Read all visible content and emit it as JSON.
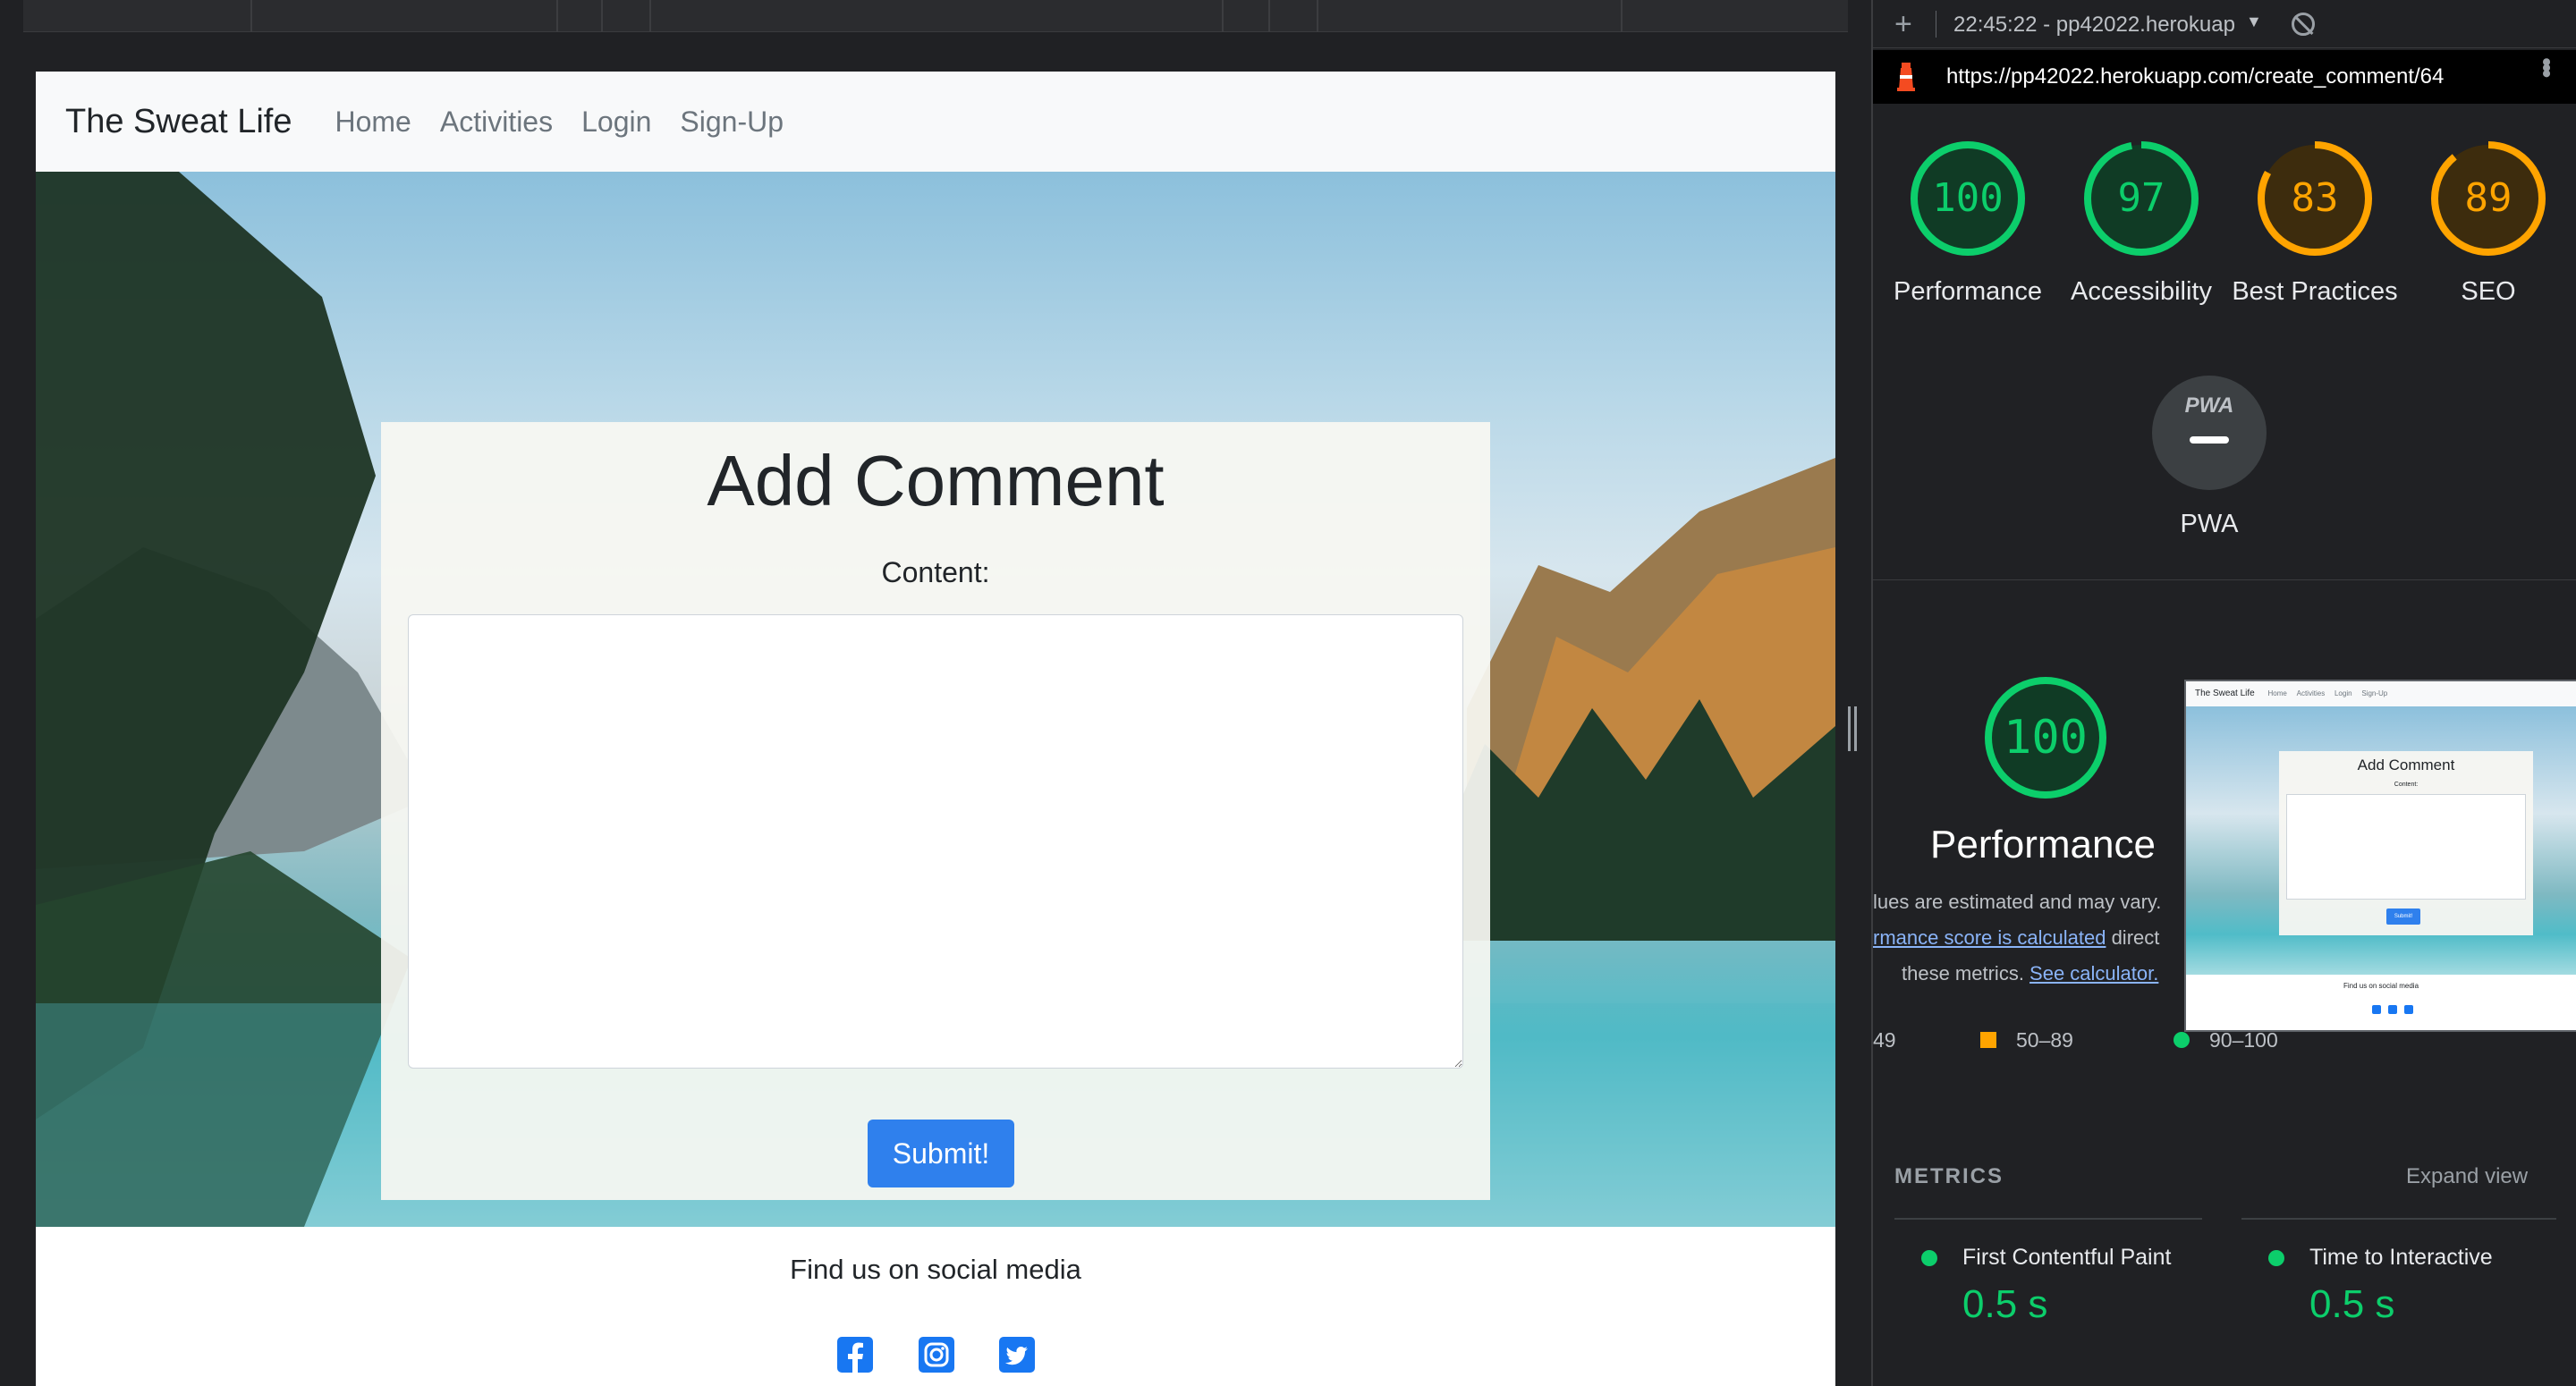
{
  "page": {
    "brand": "The Sweat Life",
    "nav": [
      "Home",
      "Activities",
      "Login",
      "Sign-Up"
    ],
    "form": {
      "title": "Add Comment",
      "content_label": "Content:",
      "content_value": "",
      "submit_label": "Submit!"
    },
    "footer": {
      "text": "Find us on social media",
      "icons": [
        "facebook-icon",
        "instagram-icon",
        "twitter-icon"
      ]
    }
  },
  "lighthouse": {
    "run_label": "22:45:22 - pp42022.herokuap",
    "url": "https://pp42022.herokuapp.com/create_comment/64",
    "scores": [
      {
        "label": "Performance",
        "value": "100",
        "color": "#0cce6b"
      },
      {
        "label": "Accessibility",
        "value": "97",
        "color": "#0cce6b"
      },
      {
        "label": "Best Practices",
        "value": "83",
        "color": "#ffa400"
      },
      {
        "label": "SEO",
        "value": "89",
        "color": "#ffa400"
      }
    ],
    "pwa_label": "PWA",
    "pwa_badge": "PWA",
    "performance": {
      "score": "100",
      "label": "Performance",
      "note_line1": "lues are estimated and may vary.",
      "note_line2_link": "rmance score is calculated",
      "note_line2_rest": " direct",
      "note_line3_pre": "these metrics. ",
      "note_line3_link": "See calculator."
    },
    "legend": [
      "49",
      "50–89",
      "90–100"
    ],
    "metrics_header": "METRICS",
    "expand_view": "Expand view",
    "metrics": [
      {
        "name": "First Contentful Paint",
        "value": "0.5 s"
      },
      {
        "name": "Time to Interactive",
        "value": "0.5 s"
      }
    ],
    "thumbnail": {
      "brand": "The Sweat Life",
      "nav": [
        "Home",
        "Activities",
        "Login",
        "Sign-Up"
      ],
      "title": "Add Comment",
      "label": "Content:",
      "submit": "Submit!",
      "footer": "Find us on social media"
    }
  },
  "colors": {
    "pass": "#0cce6b",
    "average": "#ffa400",
    "accent": "#2f80ed"
  }
}
